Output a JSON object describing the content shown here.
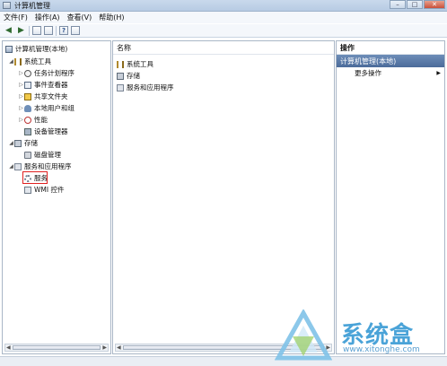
{
  "window": {
    "title": "计算机管理"
  },
  "menu": [
    "文件(F)",
    "操作(A)",
    "查看(V)",
    "帮助(H)"
  ],
  "tree": {
    "root": "计算机管理(本地)",
    "system_tools": "系统工具",
    "task_scheduler": "任务计划程序",
    "event_viewer": "事件查看器",
    "shared_folders": "共享文件夹",
    "local_users": "本地用户和组",
    "performance": "性能",
    "device_manager": "设备管理器",
    "storage": "存储",
    "disk_management": "磁盘管理",
    "services_apps": "服务和应用程序",
    "services": "服务",
    "wmi": "WMI 控件"
  },
  "middle": {
    "column_header": "名称",
    "items": [
      "系统工具",
      "存储",
      "服务和应用程序"
    ]
  },
  "actions": {
    "header": "操作",
    "section": "计算机管理(本地)",
    "more": "更多操作"
  },
  "watermark": {
    "text": "系统盒",
    "url": "www.xitonghe.com"
  }
}
